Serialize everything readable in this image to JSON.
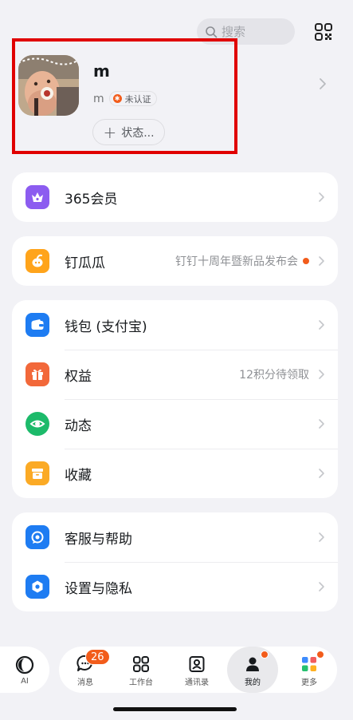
{
  "search": {
    "placeholder": "搜索"
  },
  "profile": {
    "name": "m",
    "sub_name": "m",
    "badge_label": "未认证",
    "status_label": "状态..."
  },
  "menu": {
    "vip": {
      "label": "365会员",
      "color": "#8c5cf0"
    },
    "dinggua": {
      "label": "钉瓜瓜",
      "extra": "钉钉十周年暨新品发布会",
      "color": "#ffa41b"
    },
    "wallet": {
      "label": "钱包 (支付宝)",
      "color": "#1e7cf2"
    },
    "benefits": {
      "label": "权益",
      "extra": "12积分待领取",
      "color": "#f2683a"
    },
    "moments": {
      "label": "动态",
      "color": "#1cba6a"
    },
    "favorites": {
      "label": "收藏",
      "color": "#fbaa25"
    },
    "support": {
      "label": "客服与帮助",
      "color": "#1e7cf2"
    },
    "settings": {
      "label": "设置与隐私",
      "color": "#1e7cf2"
    }
  },
  "tabs": {
    "ai": "AI",
    "messages": "消息",
    "messages_badge": "26",
    "workbench": "工作台",
    "contacts": "通讯录",
    "mine": "我的",
    "more": "更多"
  },
  "colors": {
    "accent": "#f25c1b",
    "highlight_border": "#e00000"
  }
}
